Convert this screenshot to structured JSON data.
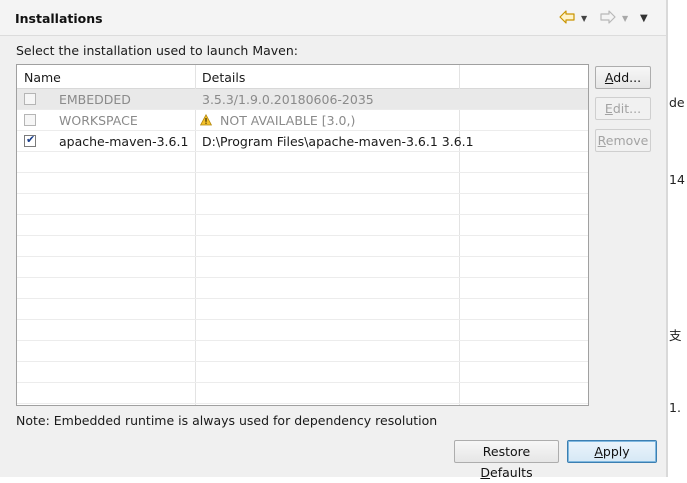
{
  "header": {
    "title": "Installations"
  },
  "prompt": "Select the installation used to launch Maven:",
  "table": {
    "columns": [
      "Name",
      "Details"
    ],
    "rows": [
      {
        "checked": false,
        "enabled": false,
        "name": "EMBEDDED",
        "details": "3.5.3/1.9.0.20180606-2035",
        "warning": false
      },
      {
        "checked": false,
        "enabled": false,
        "name": "WORKSPACE",
        "details": "NOT AVAILABLE [3.0,)",
        "warning": true
      },
      {
        "checked": true,
        "enabled": true,
        "name": "apache-maven-3.6.1",
        "details": "D:\\Program Files\\apache-maven-3.6.1 3.6.1",
        "warning": false
      }
    ]
  },
  "buttons": {
    "add": {
      "pre": "",
      "mn": "A",
      "post": "dd..."
    },
    "edit": {
      "pre": "",
      "mn": "E",
      "post": "dit..."
    },
    "remove": {
      "pre": "",
      "mn": "R",
      "post": "emove"
    },
    "restore": {
      "pre": "Restore ",
      "mn": "D",
      "post": "efaults"
    },
    "apply": {
      "pre": "",
      "mn": "A",
      "post": "pply"
    }
  },
  "note": "Note: Embedded runtime is always used for dependency resolution",
  "edge_fragments": [
    "de",
    "14",
    "支",
    "1."
  ],
  "colors": {
    "panel_bg": "#f0f0f0",
    "selected_row": "#e9e9e9",
    "primary_border": "#3c7fb1",
    "warning": "#e8b21a"
  }
}
